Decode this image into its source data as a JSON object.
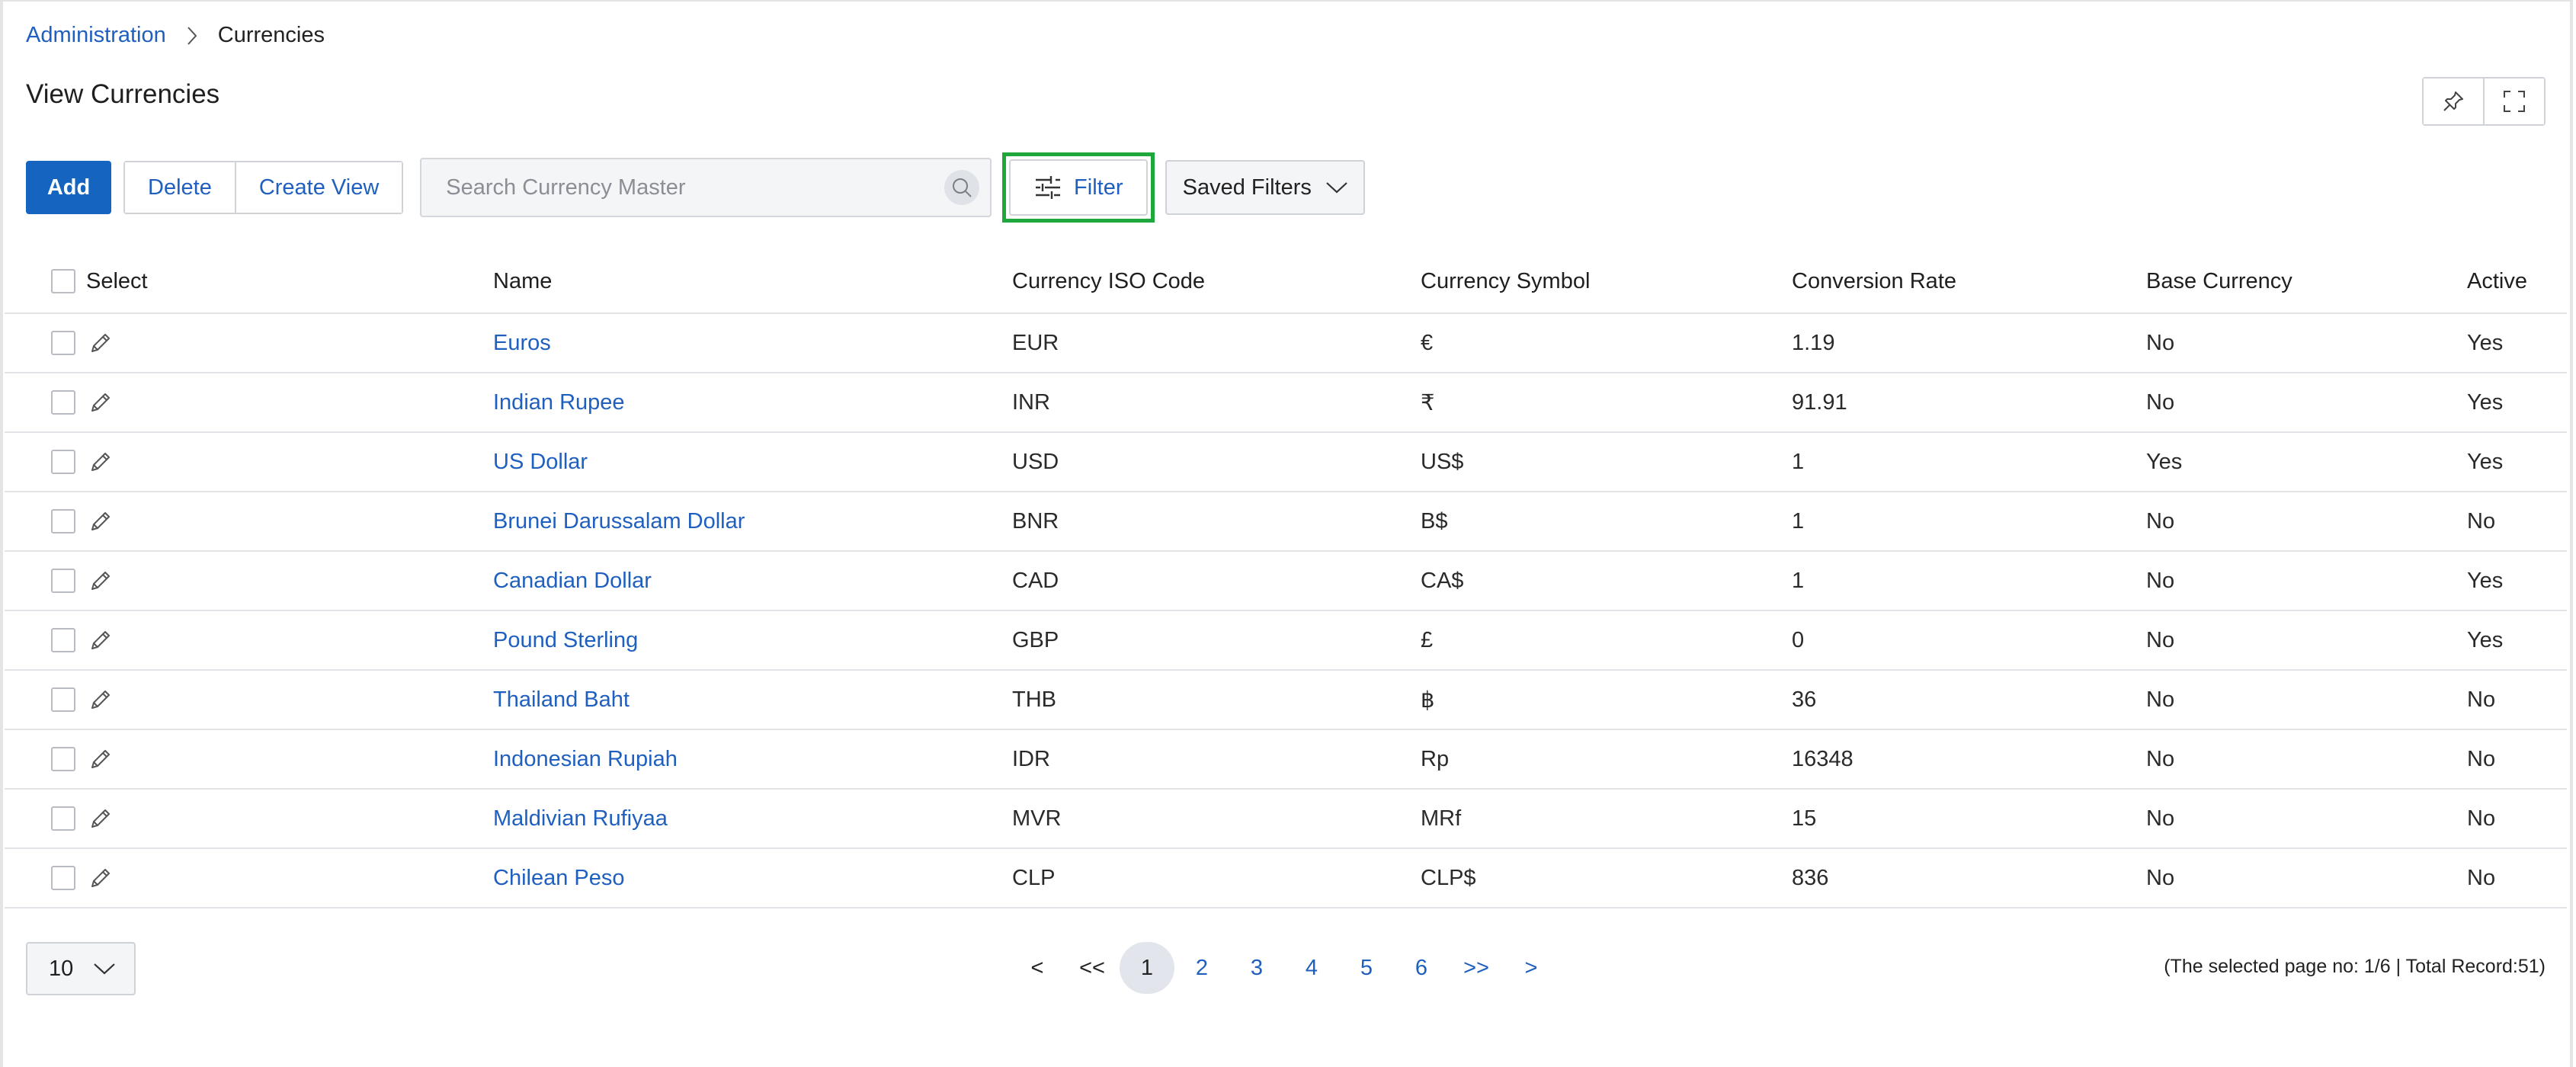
{
  "breadcrumb": {
    "parent": "Administration",
    "current": "Currencies"
  },
  "page_title": "View Currencies",
  "toolbar": {
    "add_label": "Add",
    "delete_label": "Delete",
    "create_view_label": "Create View",
    "search_placeholder": "Search Currency Master",
    "search_value": "",
    "filter_label": "Filter",
    "saved_filters_label": "Saved Filters"
  },
  "table": {
    "headers": {
      "select": "Select",
      "name": "Name",
      "iso": "Currency ISO Code",
      "symbol": "Currency Symbol",
      "rate": "Conversion Rate",
      "base": "Base Currency",
      "active": "Active"
    },
    "rows": [
      {
        "name": "Euros",
        "iso": "EUR",
        "symbol": "€",
        "rate": "1.19",
        "base": "No",
        "active": "Yes"
      },
      {
        "name": "Indian Rupee",
        "iso": "INR",
        "symbol": "₹",
        "rate": "91.91",
        "base": "No",
        "active": "Yes"
      },
      {
        "name": "US Dollar",
        "iso": "USD",
        "symbol": "US$",
        "rate": "1",
        "base": "Yes",
        "active": "Yes"
      },
      {
        "name": "Brunei Darussalam Dollar",
        "iso": "BNR",
        "symbol": "B$",
        "rate": "1",
        "base": "No",
        "active": "No"
      },
      {
        "name": "Canadian Dollar",
        "iso": "CAD",
        "symbol": "CA$",
        "rate": "1",
        "base": "No",
        "active": "Yes"
      },
      {
        "name": "Pound Sterling",
        "iso": "GBP",
        "symbol": "£",
        "rate": "0",
        "base": "No",
        "active": "Yes"
      },
      {
        "name": "Thailand Baht",
        "iso": "THB",
        "symbol": "฿",
        "rate": "36",
        "base": "No",
        "active": "No"
      },
      {
        "name": "Indonesian Rupiah",
        "iso": "IDR",
        "symbol": "Rp",
        "rate": "16348",
        "base": "No",
        "active": "No"
      },
      {
        "name": "Maldivian Rufiyaa",
        "iso": "MVR",
        "symbol": "MRf",
        "rate": "15",
        "base": "No",
        "active": "No"
      },
      {
        "name": "Chilean Peso",
        "iso": "CLP",
        "symbol": "CLP$",
        "rate": "836",
        "base": "No",
        "active": "No"
      }
    ]
  },
  "pagination": {
    "page_size": "10",
    "prev": "<",
    "first": "<<",
    "pages": [
      "1",
      "2",
      "3",
      "4",
      "5",
      "6"
    ],
    "current_page": "1",
    "last": ">>",
    "next": ">",
    "info": "(The selected page no: 1/6 | Total Record:51)"
  },
  "colors": {
    "accent": "#1565c0",
    "link": "#1f5fbf",
    "highlight": "#1ea83c"
  },
  "icons": [
    "chevron-right-icon",
    "pin-icon",
    "fullscreen-icon",
    "search-icon",
    "sliders-icon",
    "chevron-down-icon",
    "edit-pencil-icon"
  ]
}
